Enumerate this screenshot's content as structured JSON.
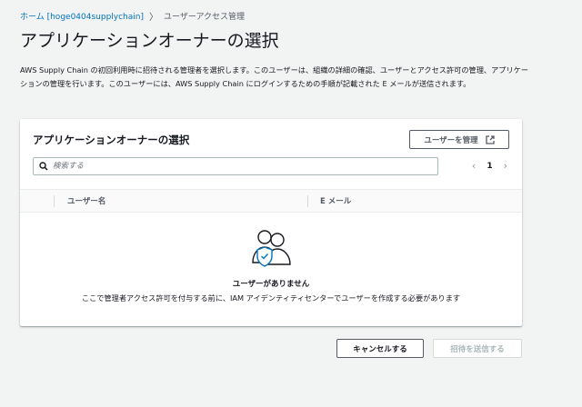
{
  "breadcrumb": {
    "home": "ホーム [hoge0404supplychain]",
    "separator": "〉",
    "current": "ユーザーアクセス管理"
  },
  "page_title": "アプリケーションオーナーの選択",
  "description": "AWS Supply Chain の初回利用時に招待される管理者を選択します。このユーザーは、組織の詳細の確認、ユーザーとアクセス許可の管理、アプリケーションの管理を行います。このユーザーには、AWS Supply Chain にログインするための手順が記載された E メールが送信されます。",
  "panel": {
    "title": "アプリケーションオーナーの選択",
    "manage_button": "ユーザーを管理",
    "search_placeholder": "検索する",
    "pagination": {
      "prev": "‹",
      "page": "1",
      "next": "›"
    },
    "columns": [
      "ユーザー名",
      "E メール"
    ],
    "empty_title": "ユーザーがありません",
    "empty_description": "ここで管理者アクセス許可を付与する前に、IAM アイデンティティセンターでユーザーを作成する必要があります"
  },
  "footer": {
    "cancel": "キャンセルする",
    "send_invite": "招待を送信する"
  },
  "colors": {
    "link": "#0073bb",
    "background": "#f2f3f3",
    "disabled_text": "#aab7b8"
  }
}
